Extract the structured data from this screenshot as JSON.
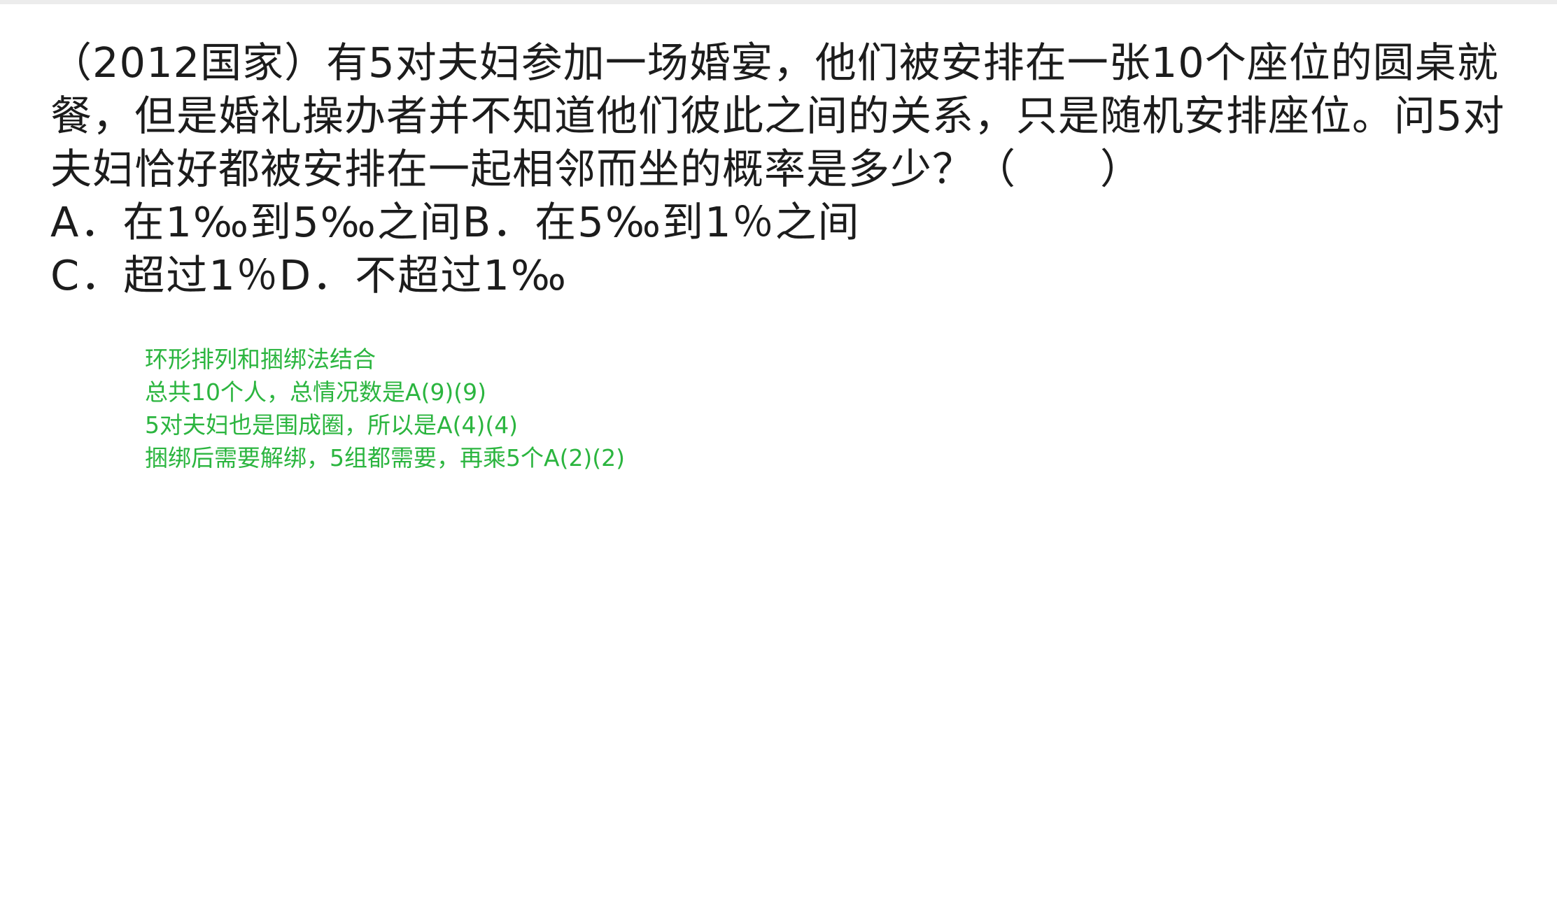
{
  "question": {
    "text": "（2012国家）有5对夫妇参加一场婚宴，他们被安排在一张10个座位的圆桌就餐，但是婚礼操办者并不知道他们彼此之间的关系，只是随机安排座位。问5对夫妇恰好都被安排在一起相邻而坐的概率是多少？（　　）",
    "options": [
      {
        "label": "A．",
        "text": "在1‰到5‰之间"
      },
      {
        "label": "B．",
        "text": "在5‰到1％之间"
      },
      {
        "label": "C．",
        "text": "超过1％"
      },
      {
        "label": "D．",
        "text": "不超过1‰"
      }
    ]
  },
  "notes": [
    "环形排列和捆绑法结合",
    "总共10个人，总情况数是A(9)(9)",
    "5对夫妇也是围成圈，所以是A(4)(4)",
    "捆绑后需要解绑，5组都需要，再乘5个A(2)(2)"
  ],
  "colors": {
    "question_text": "#1c1c1c",
    "notes_text": "#2bb53f",
    "background": "#ffffff"
  }
}
